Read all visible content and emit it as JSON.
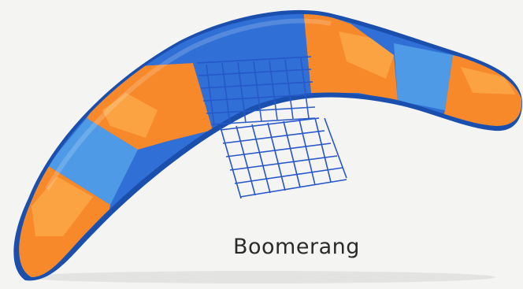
{
  "caption": "Boomerang",
  "colors": {
    "background": "#f4f4f3",
    "orange": "#f7892a",
    "orange_light": "#fba343",
    "orange_dark": "#e0701b",
    "blue": "#2f6fd6",
    "blue_light": "#4e9ae6",
    "blue_dark": "#1b4fae",
    "grid": "#2757c9",
    "caption_text": "#2a2a2a"
  },
  "object": {
    "name": "boomerang",
    "pattern": [
      "orange",
      "blue",
      "orange",
      "blue",
      "orange",
      "blue",
      "orange",
      "blue",
      "orange"
    ],
    "overlay": "wireframe-grid"
  }
}
